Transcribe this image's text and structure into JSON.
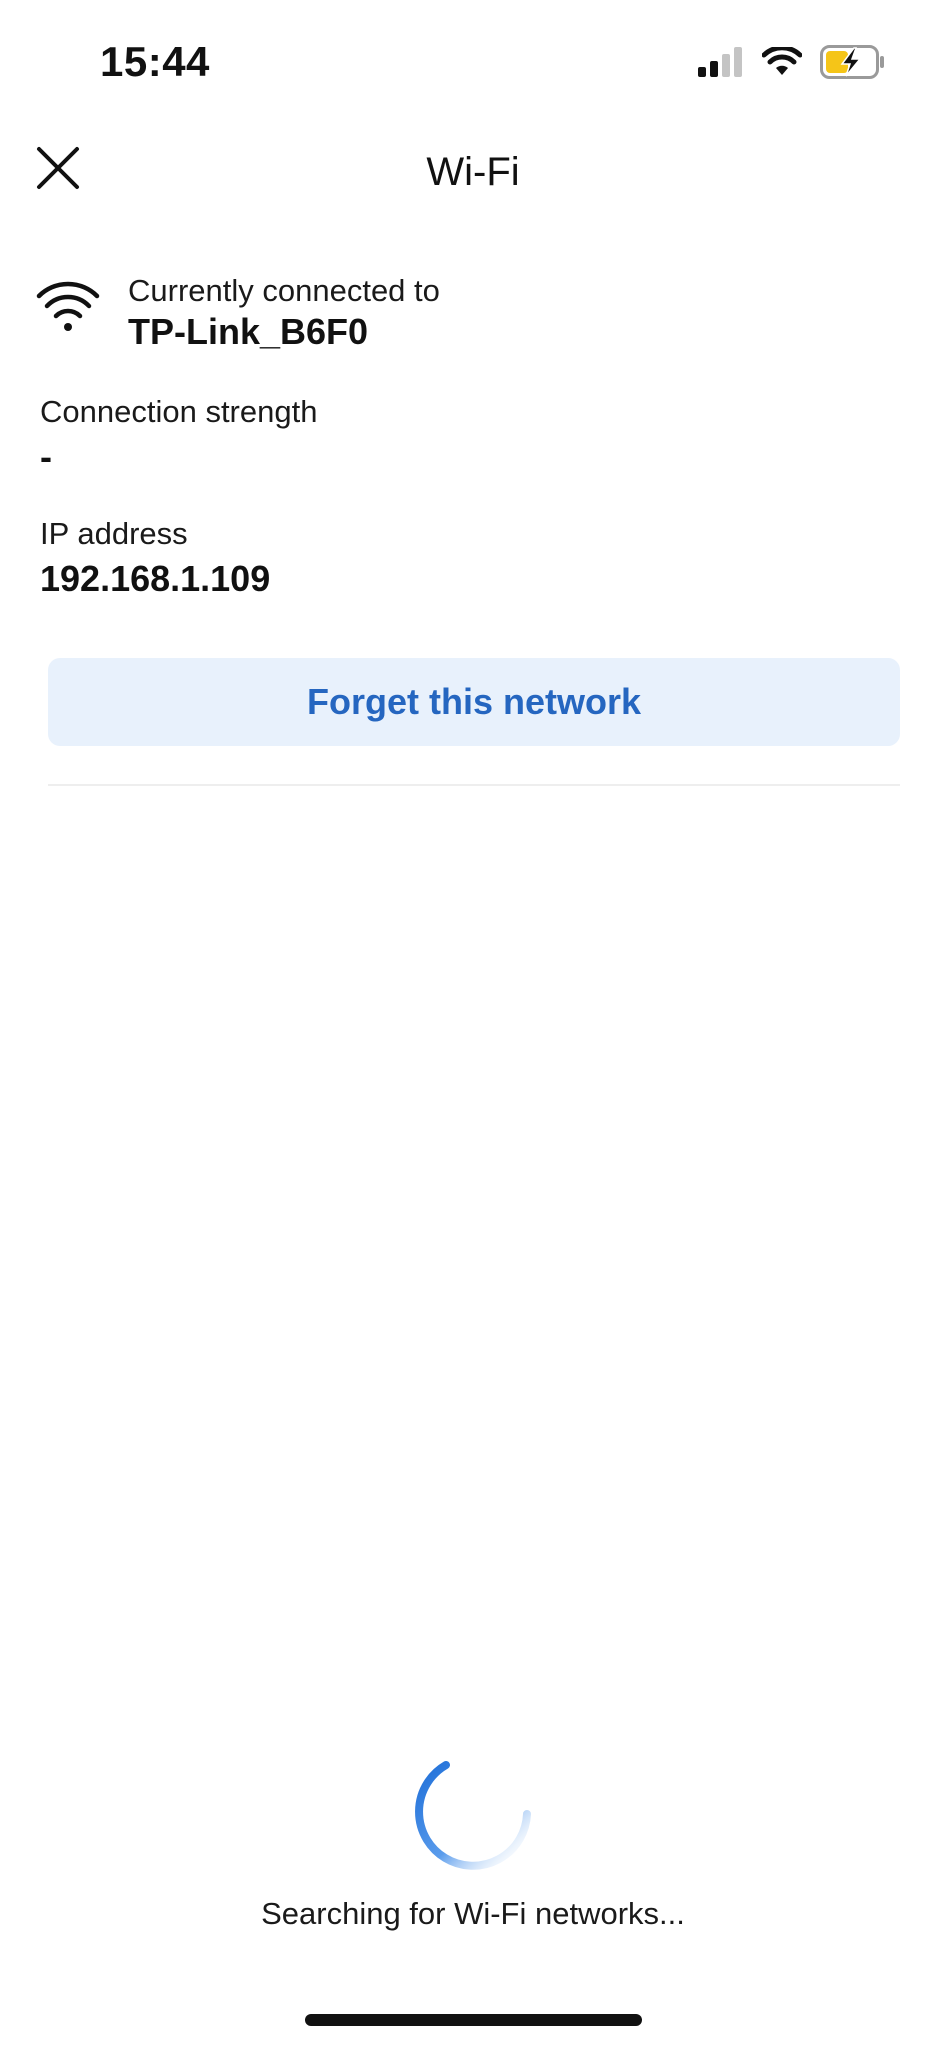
{
  "status_bar": {
    "time": "15:44",
    "icons": [
      "cellular-signal-icon",
      "wifi-status-icon",
      "battery-charging-icon"
    ],
    "battery_color": "#f5c518"
  },
  "nav": {
    "title": "Wi-Fi",
    "close_icon": "close-icon"
  },
  "connection": {
    "label": "Currently connected to",
    "network_name": "TP-Link_B6F0",
    "icon": "wifi-icon"
  },
  "details": {
    "strength_label": "Connection strength",
    "strength_value": "-",
    "ip_label": "IP address",
    "ip_value": "192.168.1.109"
  },
  "actions": {
    "forget_label": "Forget this network"
  },
  "search": {
    "status_text": "Searching for Wi-Fi networks...",
    "spinner_icon": "loading-spinner-icon"
  },
  "colors": {
    "accent": "#2566c0",
    "button_bg": "#e8f1fc",
    "spinner": "#2f7fe0"
  }
}
